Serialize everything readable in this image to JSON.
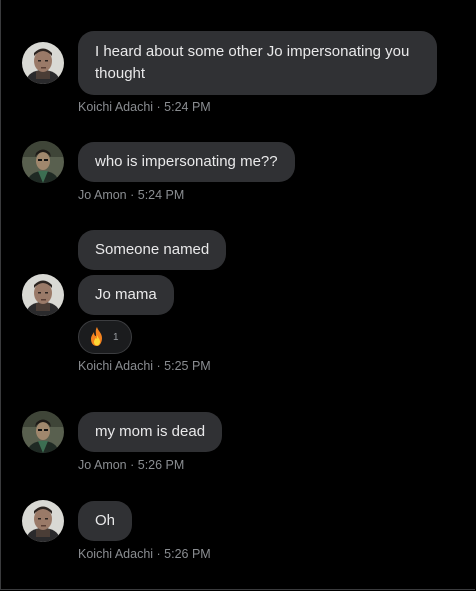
{
  "messages": [
    {
      "sender": "Koichi Adachi",
      "time": "5:24 PM",
      "meta": "Koichi Adachi · 5:24 PM",
      "bubbles": [
        "I heard about some other Jo impersonating you thought"
      ]
    },
    {
      "sender": "Jo Amon",
      "time": "5:24 PM",
      "meta": "Jo Amon · 5:24 PM",
      "bubbles": [
        "who is impersonating me??"
      ]
    },
    {
      "sender": "Koichi Adachi",
      "time": "5:25 PM",
      "meta": "Koichi Adachi · 5:25 PM",
      "bubbles": [
        "Someone named",
        "Jo mama"
      ],
      "reaction": {
        "icon": "fire-icon",
        "count": "1"
      }
    },
    {
      "sender": "Jo Amon",
      "time": "5:26 PM",
      "meta": "Jo Amon · 5:26 PM",
      "bubbles": [
        "my mom is dead"
      ]
    },
    {
      "sender": "Koichi Adachi",
      "time": "5:26 PM",
      "meta": "Koichi Adachi · 5:26 PM",
      "bubbles": [
        "Oh"
      ]
    }
  ],
  "colors": {
    "background": "#000000",
    "bubble": "#303134",
    "bubble_text": "#e9e9ea",
    "meta_text": "#8a8d91"
  }
}
